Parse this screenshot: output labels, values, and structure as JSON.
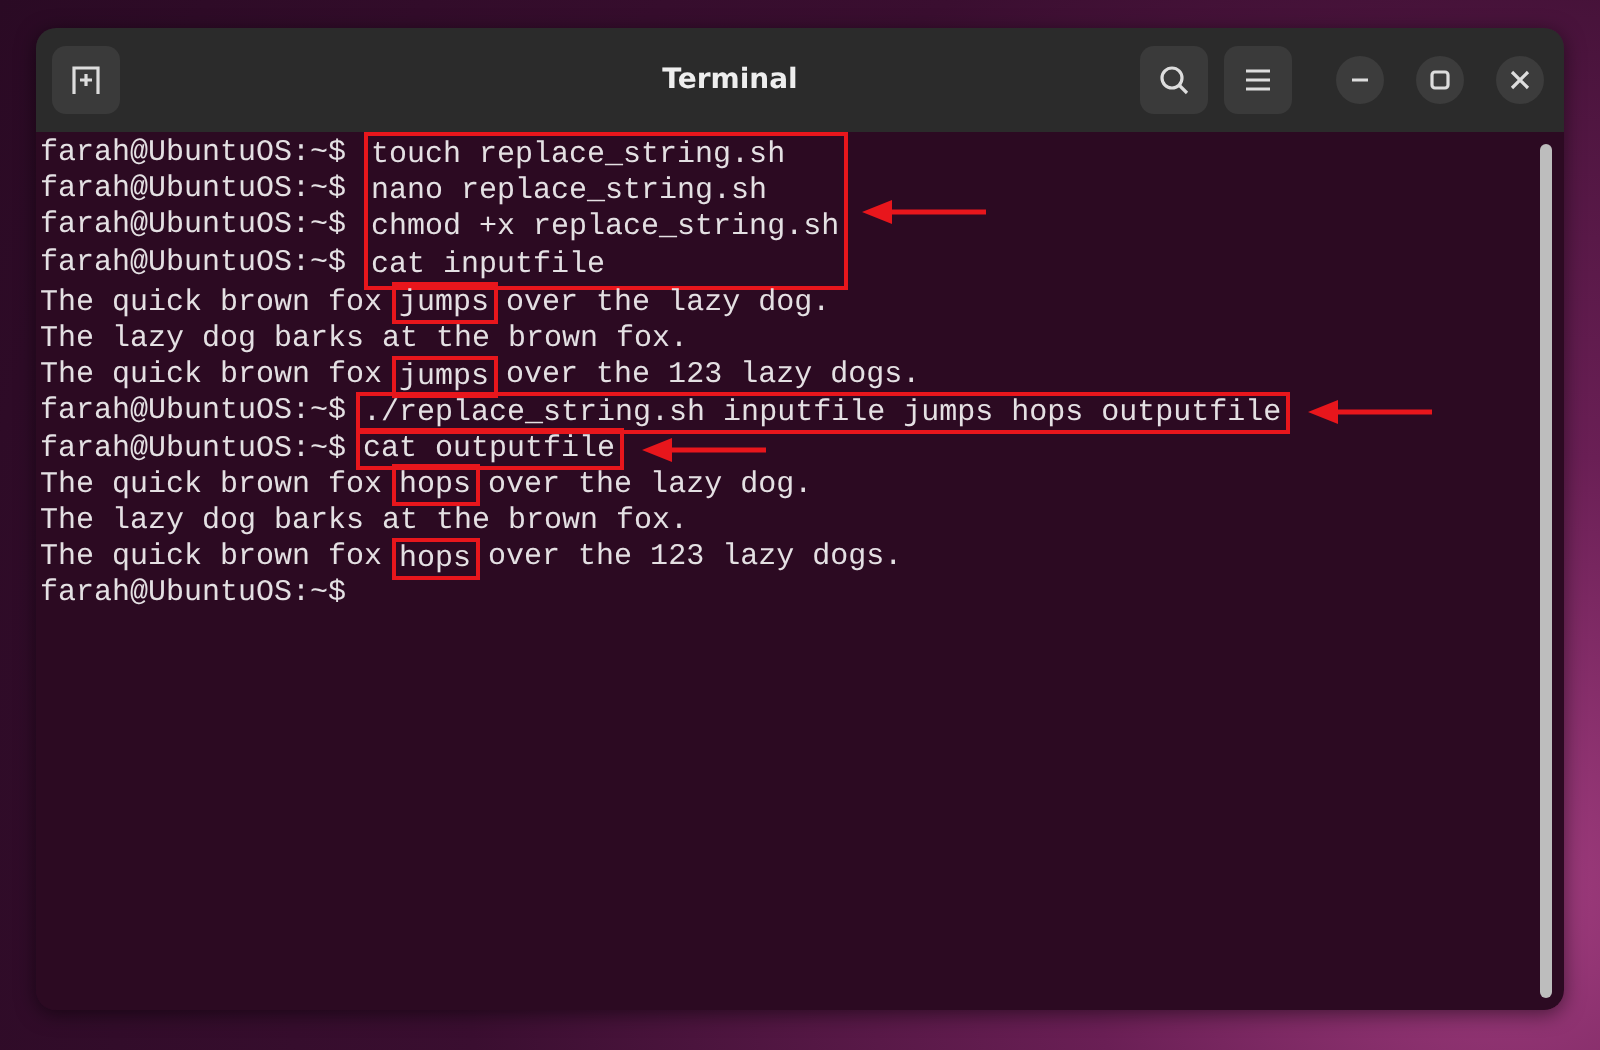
{
  "window": {
    "title": "Terminal"
  },
  "terminal": [
    {
      "kind": "group",
      "arrow": true,
      "lines": [
        {
          "prompt": "farah@UbuntuOS:~$",
          "segments": [
            {
              "text": "touch replace_string.sh",
              "boxed": false
            }
          ]
        },
        {
          "prompt": "farah@UbuntuOS:~$",
          "segments": [
            {
              "text": "nano replace_string.sh",
              "boxed": false
            }
          ]
        },
        {
          "prompt": "farah@UbuntuOS:~$",
          "segments": [
            {
              "text": "chmod +x replace_string.sh",
              "boxed": false
            }
          ]
        },
        {
          "prompt": "farah@UbuntuOS:~$",
          "segments": [
            {
              "text": "cat inputfile",
              "boxed": false
            }
          ]
        }
      ]
    },
    {
      "kind": "line",
      "arrow": false,
      "segments": [
        {
          "text": "The quick brown fox ",
          "boxed": false
        },
        {
          "text": "jumps",
          "boxed": true
        },
        {
          "text": " over the lazy dog.",
          "boxed": false
        }
      ]
    },
    {
      "kind": "line",
      "arrow": false,
      "segments": [
        {
          "text": "The lazy dog barks at the brown fox.",
          "boxed": false
        }
      ]
    },
    {
      "kind": "line",
      "arrow": false,
      "segments": [
        {
          "text": "The quick brown fox ",
          "boxed": false
        },
        {
          "text": "jumps",
          "boxed": true
        },
        {
          "text": " over the 123 lazy dogs.",
          "boxed": false
        }
      ]
    },
    {
      "kind": "line",
      "arrow": true,
      "prompt": "farah@UbuntuOS:~$",
      "segments": [
        {
          "text": "./replace_string.sh inputfile jumps hops outputfile",
          "boxed": true
        }
      ]
    },
    {
      "kind": "line",
      "arrow": true,
      "prompt": "farah@UbuntuOS:~$",
      "segments": [
        {
          "text": "cat outputfile",
          "boxed": true
        }
      ]
    },
    {
      "kind": "line",
      "arrow": false,
      "segments": [
        {
          "text": "The quick brown fox ",
          "boxed": false
        },
        {
          "text": "hops",
          "boxed": true
        },
        {
          "text": " over the lazy dog.",
          "boxed": false
        }
      ]
    },
    {
      "kind": "line",
      "arrow": false,
      "segments": [
        {
          "text": "The lazy dog barks at the brown fox.",
          "boxed": false
        }
      ]
    },
    {
      "kind": "line",
      "arrow": false,
      "segments": [
        {
          "text": "The quick brown fox ",
          "boxed": false
        },
        {
          "text": "hops",
          "boxed": true
        },
        {
          "text": " over the 123 lazy dogs.",
          "boxed": false
        }
      ]
    },
    {
      "kind": "line",
      "arrow": false,
      "prompt": "farah@UbuntuOS:~$"
    }
  ]
}
